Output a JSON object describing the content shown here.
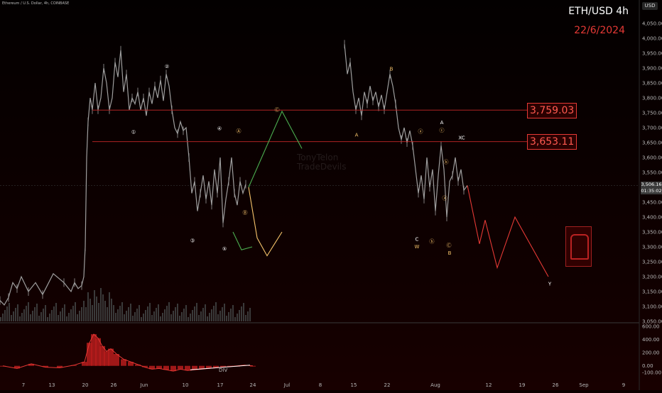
{
  "header": {
    "symbol_line": "Ethereum / U.S. Dollar, 4h, COINBASE",
    "pair_title": "ETH/USD 4h",
    "date_title": "22/6/2024",
    "currency_button": "USD",
    "watermark": [
      "TonyTelon",
      "TradeDevils"
    ]
  },
  "current_price": {
    "value": "3,506.16",
    "countdown": "01:35:02"
  },
  "levels": [
    {
      "price": 3759.03,
      "label": "3,759.03"
    },
    {
      "price": 3653.11,
      "label": "3,653.11"
    }
  ],
  "colors": {
    "background": "#0b0000",
    "candles": "#9e9e9e",
    "level_line": "#c62828",
    "green_path": "#4caf50",
    "yellow_path": "#f6c36b",
    "red_path": "#e53935",
    "macd_hist": "#b71c1c",
    "macd_line": "#e53935",
    "div_line": "#ffffff"
  },
  "chart_data": [
    {
      "type": "line",
      "title": "",
      "ylim": [
        3050,
        4100
      ],
      "price_ticks": [
        "4,050.00",
        "4,000.00",
        "3,950.00",
        "3,900.00",
        "3,850.00",
        "3,800.00",
        "3,750.00",
        "3,700.00",
        "3,650.00",
        "3,600.00",
        "3,550.00",
        "3,500.00",
        "3,450.00",
        "3,400.00",
        "3,350.00",
        "3,300.00",
        "3,250.00",
        "3,200.00",
        "3,150.00",
        "3,100.00",
        "3,050.00"
      ],
      "time_ticks": [
        "7",
        "13",
        "20",
        "26",
        "Jun",
        "10",
        "17",
        "24",
        "Jul",
        "8",
        "15",
        "22",
        "Aug",
        "12",
        "19",
        "26",
        "Sep",
        "9"
      ],
      "series": [
        {
          "points": [
            [
              0,
              3120
            ],
            [
              6,
              3105
            ],
            [
              12,
              3130
            ],
            [
              18,
              3180
            ],
            [
              24,
              3160
            ],
            [
              30,
              3200
            ],
            [
              40,
              3150
            ],
            [
              50,
              3180
            ],
            [
              60,
              3140
            ],
            [
              75,
              3210
            ],
            [
              90,
              3180
            ],
            [
              100,
              3150
            ],
            [
              105,
              3180
            ],
            [
              110,
              3160
            ],
            [
              115,
              3170
            ],
            [
              118,
              3200
            ],
            [
              120,
              3300
            ],
            [
              122,
              3600
            ],
            [
              124,
              3720
            ],
            [
              127,
              3800
            ],
            [
              130,
              3760
            ],
            [
              134,
              3850
            ],
            [
              138,
              3760
            ],
            [
              142,
              3800
            ],
            [
              146,
              3900
            ],
            [
              150,
              3850
            ],
            [
              154,
              3760
            ],
            [
              158,
              3800
            ],
            [
              162,
              3920
            ],
            [
              166,
              3870
            ],
            [
              170,
              3960
            ],
            [
              174,
              3820
            ],
            [
              178,
              3880
            ],
            [
              182,
              3760
            ],
            [
              186,
              3800
            ],
            [
              190,
              3780
            ],
            [
              194,
              3820
            ],
            [
              198,
              3760
            ],
            [
              202,
              3800
            ],
            [
              206,
              3740
            ],
            [
              210,
              3820
            ],
            [
              214,
              3780
            ],
            [
              218,
              3840
            ],
            [
              222,
              3800
            ],
            [
              226,
              3860
            ],
            [
              230,
              3790
            ],
            [
              234,
              3880
            ],
            [
              238,
              3840
            ],
            [
              242,
              3760
            ],
            [
              246,
              3700
            ],
            [
              250,
              3680
            ],
            [
              254,
              3720
            ],
            [
              258,
              3690
            ],
            [
              262,
              3700
            ],
            [
              266,
              3600
            ],
            [
              270,
              3480
            ],
            [
              274,
              3520
            ],
            [
              278,
              3420
            ],
            [
              282,
              3480
            ],
            [
              286,
              3540
            ],
            [
              290,
              3460
            ],
            [
              294,
              3520
            ],
            [
              298,
              3440
            ],
            [
              302,
              3560
            ],
            [
              306,
              3480
            ],
            [
              310,
              3600
            ],
            [
              314,
              3380
            ],
            [
              318,
              3460
            ],
            [
              322,
              3520
            ],
            [
              326,
              3600
            ],
            [
              330,
              3480
            ],
            [
              334,
              3440
            ],
            [
              338,
              3520
            ],
            [
              342,
              3480
            ],
            [
              346,
              3510
            ]
          ]
        },
        {
          "points": [
            [
              485,
              3980
            ],
            [
              489,
              3880
            ],
            [
              493,
              3920
            ],
            [
              497,
              3820
            ],
            [
              501,
              3760
            ],
            [
              505,
              3800
            ],
            [
              509,
              3740
            ],
            [
              513,
              3820
            ],
            [
              517,
              3780
            ],
            [
              521,
              3840
            ],
            [
              525,
              3790
            ],
            [
              529,
              3820
            ],
            [
              533,
              3770
            ],
            [
              537,
              3810
            ],
            [
              541,
              3760
            ],
            [
              545,
              3820
            ],
            [
              549,
              3880
            ],
            [
              553,
              3840
            ],
            [
              557,
              3780
            ],
            [
              561,
              3700
            ],
            [
              565,
              3660
            ],
            [
              569,
              3700
            ],
            [
              573,
              3650
            ],
            [
              577,
              3690
            ],
            [
              581,
              3640
            ],
            [
              585,
              3560
            ],
            [
              589,
              3480
            ],
            [
              593,
              3540
            ],
            [
              597,
              3460
            ],
            [
              601,
              3600
            ],
            [
              605,
              3500
            ],
            [
              609,
              3560
            ],
            [
              613,
              3420
            ],
            [
              617,
              3540
            ],
            [
              621,
              3640
            ],
            [
              625,
              3560
            ],
            [
              629,
              3400
            ],
            [
              633,
              3520
            ],
            [
              637,
              3540
            ],
            [
              641,
              3600
            ],
            [
              645,
              3520
            ],
            [
              649,
              3560
            ],
            [
              653,
              3490
            ],
            [
              658,
              3506
            ]
          ]
        }
      ],
      "projections": [
        {
          "name": "green",
          "points": [
            [
              350,
              3500
            ],
            [
              397,
              3755
            ],
            [
              425,
              3630
            ]
          ]
        },
        {
          "name": "green-2",
          "points": [
            [
              328,
              3350
            ],
            [
              340,
              3290
            ],
            [
              355,
              3300
            ]
          ]
        },
        {
          "name": "yellow",
          "points": [
            [
              350,
              3500
            ],
            [
              362,
              3330
            ],
            [
              376,
              3270
            ],
            [
              397,
              3350
            ]
          ]
        },
        {
          "name": "red",
          "points": [
            [
              658,
              3506
            ],
            [
              675,
              3310
            ],
            [
              683,
              3390
            ],
            [
              700,
              3230
            ],
            [
              725,
              3400
            ],
            [
              772,
              3200
            ]
          ]
        }
      ],
      "wave_labels": [
        {
          "text": "①",
          "price": 3685,
          "x": 188,
          "color": "#ffffff"
        },
        {
          "text": "②",
          "price": 3905,
          "x": 235,
          "color": "#ffffff"
        },
        {
          "text": "③",
          "price": 3320,
          "x": 271,
          "color": "#ffffff"
        },
        {
          "text": "④",
          "price": 3697,
          "x": 309,
          "color": "#ffffff"
        },
        {
          "text": "⑤",
          "price": 3293,
          "x": 316,
          "color": "#ffffff"
        },
        {
          "text": "Ⓐ",
          "price": 3688,
          "x": 336,
          "color": "#f6c36b"
        },
        {
          "text": "Ⓑ",
          "price": 3414,
          "x": 345,
          "color": "#f6c36b"
        },
        {
          "text": "Ⓒ",
          "price": 3760,
          "x": 390,
          "color": "#f6c36b"
        },
        {
          "text": "A",
          "price": 3675,
          "x": 502,
          "color": "#f6c36b"
        },
        {
          "text": "B",
          "price": 3896,
          "x": 551,
          "color": "#f6c36b"
        },
        {
          "text": "ⓐ",
          "price": 3687,
          "x": 592,
          "color": "#f6c36b"
        },
        {
          "text": "C",
          "price": 3325,
          "x": 587,
          "color": "#ffffff"
        },
        {
          "text": "W",
          "price": 3300,
          "x": 587,
          "color": "#f6c36b"
        },
        {
          "text": "ⓑ",
          "price": 3318,
          "x": 608,
          "color": "#f6c36b"
        },
        {
          "text": "A",
          "price": 3717,
          "x": 622,
          "color": "#ffffff"
        },
        {
          "text": "ⓒ",
          "price": 3690,
          "x": 622,
          "color": "#f6c36b"
        },
        {
          "text": "ⓑ",
          "price": 3585,
          "x": 628,
          "color": "#f6c36b"
        },
        {
          "text": "ⓐ",
          "price": 3463,
          "x": 626,
          "color": "#f6c36b"
        },
        {
          "text": "Ⓒ",
          "price": 3305,
          "x": 632,
          "color": "#f6c36b"
        },
        {
          "text": "B",
          "price": 3278,
          "x": 633,
          "color": "#f6c36b"
        },
        {
          "text": "XC",
          "price": 3665,
          "x": 650,
          "color": "#ffffff"
        },
        {
          "text": "Y",
          "price": 3175,
          "x": 774,
          "color": "#ffffff"
        }
      ]
    },
    {
      "type": "area",
      "title": "",
      "ylim": [
        -150,
        650
      ],
      "ticks": [
        "600.00",
        "400.00",
        "200.00",
        "0.00",
        "-100.00"
      ],
      "annotation": "DIV",
      "hist_points": [
        [
          0,
          0
        ],
        [
          20,
          -40
        ],
        [
          40,
          30
        ],
        [
          60,
          -20
        ],
        [
          80,
          -30
        ],
        [
          100,
          10
        ],
        [
          115,
          60
        ],
        [
          122,
          350
        ],
        [
          128,
          480
        ],
        [
          134,
          420
        ],
        [
          140,
          300
        ],
        [
          146,
          220
        ],
        [
          152,
          260
        ],
        [
          160,
          180
        ],
        [
          170,
          100
        ],
        [
          180,
          60
        ],
        [
          190,
          20
        ],
        [
          200,
          -20
        ],
        [
          210,
          -50
        ],
        [
          220,
          -40
        ],
        [
          230,
          -60
        ],
        [
          240,
          -80
        ],
        [
          250,
          -50
        ],
        [
          260,
          -70
        ],
        [
          270,
          -60
        ],
        [
          280,
          -50
        ],
        [
          290,
          -40
        ],
        [
          300,
          -30
        ],
        [
          310,
          -20
        ],
        [
          320,
          -10
        ],
        [
          330,
          0
        ],
        [
          340,
          10
        ],
        [
          352,
          0
        ]
      ]
    }
  ]
}
